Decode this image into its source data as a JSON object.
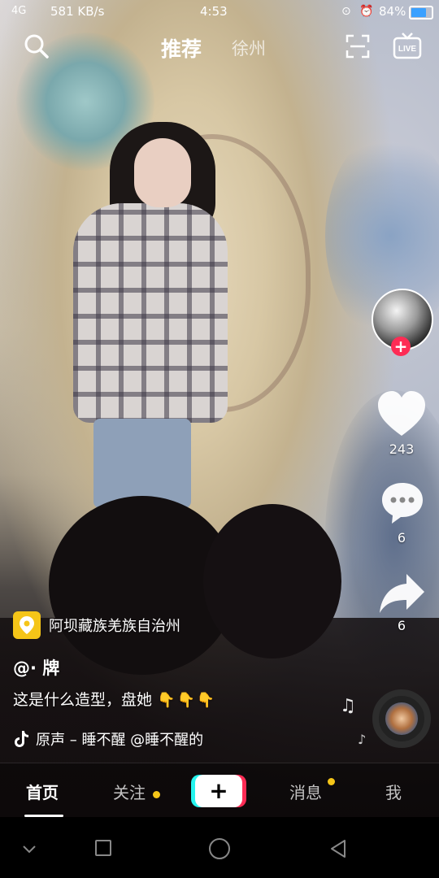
{
  "status_bar": {
    "signal": "4G",
    "net_speed": "581 KB/s",
    "time": "4:53",
    "battery_pct": "84%",
    "battery_level": 0.84,
    "battery_color": "#3aa0ff"
  },
  "top_nav": {
    "search_icon": "search-icon",
    "tab_recommend": "推荐",
    "tab_city": "徐州",
    "scan_icon": "scan-icon",
    "live_icon": "live-icon",
    "live_label": "LIVE"
  },
  "sidebar": {
    "follow_plus": "+",
    "likes": "243",
    "comments": "6",
    "shares": "6"
  },
  "post": {
    "location": "阿坝藏族羌族自治州",
    "author": "@· 牌",
    "caption": "这是什么造型，盘她",
    "caption_emoji": "👇👇👇",
    "music": "原声 – 睡不醒    @睡不醒的"
  },
  "tab_bar": {
    "home": "首页",
    "following": "关注",
    "add": "+",
    "messages": "消息",
    "me": "我",
    "accent_cyan": "#25f4ee",
    "accent_red": "#fe2c55",
    "dot_color": "#f5c518"
  }
}
